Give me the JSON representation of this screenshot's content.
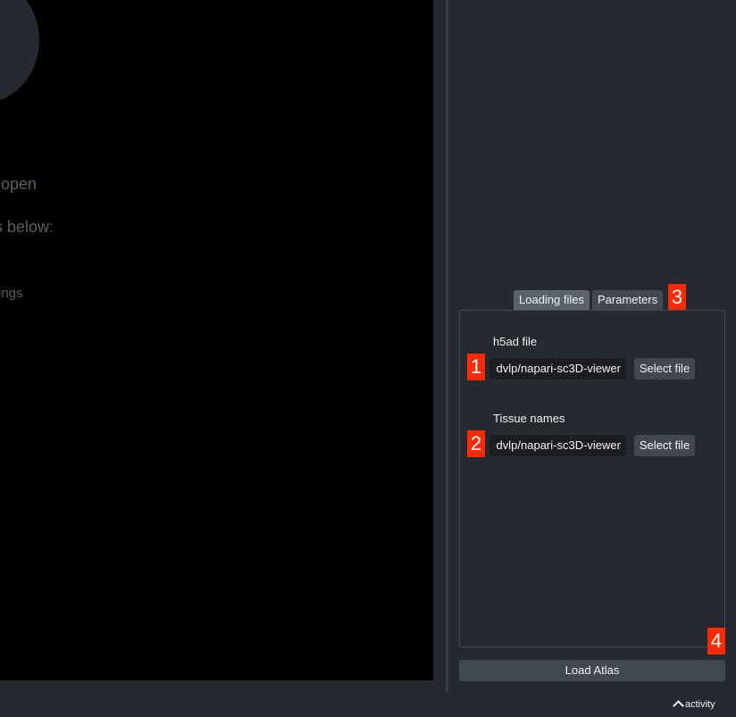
{
  "canvas": {
    "welcome_lines": [
      "o open",
      "s below:",
      "ings"
    ]
  },
  "dock": {
    "tabs": [
      {
        "label": "Loading files",
        "active": true
      },
      {
        "label": "Parameters",
        "active": false
      }
    ],
    "h5ad": {
      "label": "h5ad file",
      "value": "dvlp/napari-sc3D-viewer",
      "button": "Select file"
    },
    "tissue": {
      "label": "Tissue names",
      "value": "dvlp/napari-sc3D-viewer",
      "button": "Select file"
    },
    "load_button": "Load Atlas"
  },
  "annotations": [
    "1",
    "2",
    "3",
    "4"
  ],
  "status": {
    "activity_label": "activity",
    "activity_icon": "chevron-up-icon"
  },
  "colors": {
    "background": "#262930",
    "canvas": "#000000",
    "annotation": "#ff2a00",
    "button": "#414851"
  }
}
